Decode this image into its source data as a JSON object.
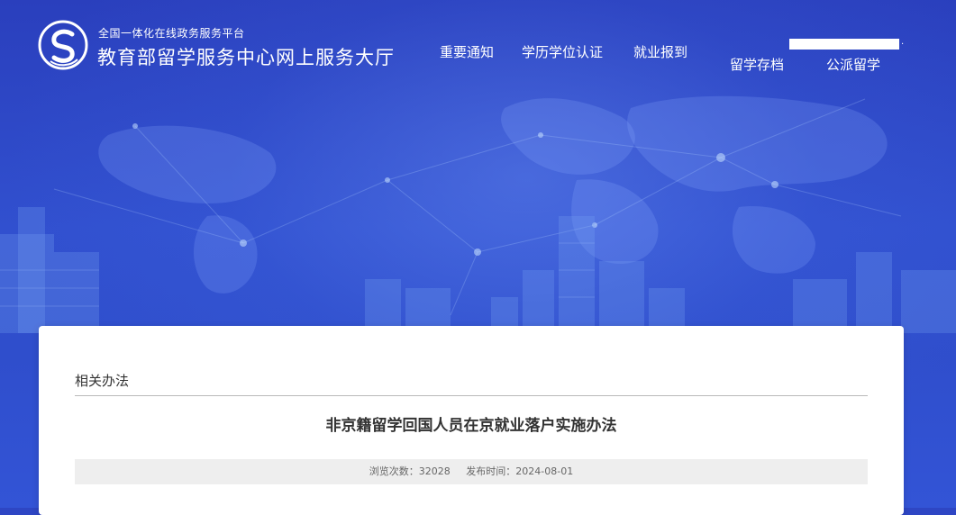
{
  "header": {
    "brand_subtitle": "全国一体化在线政务服务平台",
    "brand_title": "教育部留学服务中心网上服务大厅",
    "logo_icon": "cscse-logo-icon"
  },
  "nav": {
    "items": [
      {
        "label": "重要通知"
      },
      {
        "label": "学历学位认证"
      },
      {
        "label": "就业报到"
      },
      {
        "label": "留学存档"
      },
      {
        "label": "公派留学"
      }
    ],
    "user_indicator": "."
  },
  "content": {
    "section_label": "相关办法",
    "article_title": "非京籍留学回国人员在京就业落户实施办法",
    "views_label": "浏览次数：",
    "views_count": "32028",
    "publish_label": "发布时间：",
    "publish_date": "2024-08-01"
  },
  "colors": {
    "background_blue": "#2e46c4",
    "card_bg": "#ffffff",
    "meta_bar_bg": "#eeeeee"
  }
}
